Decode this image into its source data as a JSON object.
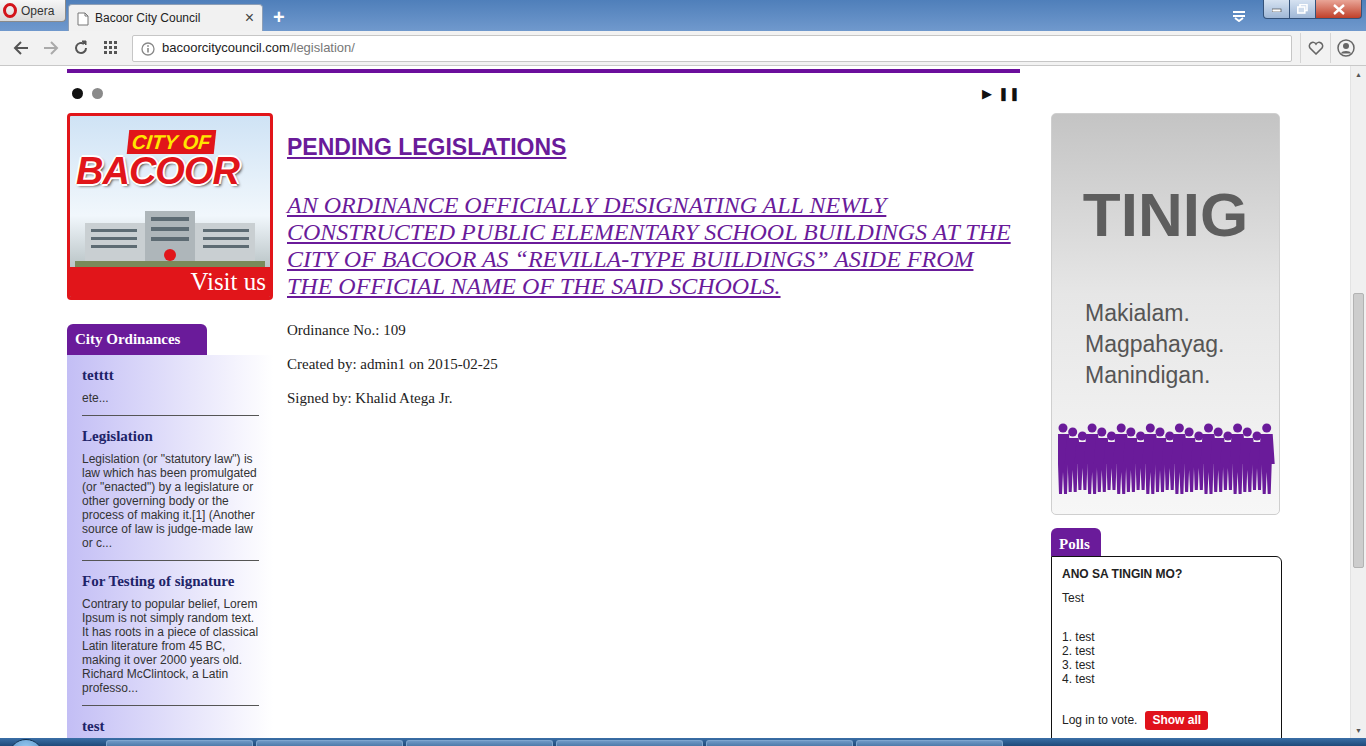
{
  "browser": {
    "menu_button": "Opera",
    "tabs": [
      {
        "label": "Bacoor City Council",
        "close": "×",
        "selected": true
      }
    ],
    "new_tab": "+",
    "address": {
      "host": "bacoorcitycouncil.com",
      "path": "/legislation/"
    }
  },
  "slider": {
    "dots": [
      {
        "selected": true
      },
      {
        "selected": false
      }
    ],
    "play": "▶",
    "pause": "❚❚"
  },
  "logo": {
    "line1": "CITY OF",
    "line2": "BACOOR",
    "cta": "Visit us"
  },
  "ordinances": {
    "title": "City Ordinances",
    "items": [
      {
        "title": "tetttt",
        "excerpt": "ete..."
      },
      {
        "title": "Legislation",
        "excerpt": "Legislation (or \"statutory law\") is law which has been promulgated (or \"enacted\") by a legislature or other governing body or the process of making it.[1] (Another source of law is judge-made law or c..."
      },
      {
        "title": "For Testing of signature",
        "excerpt": "Contrary to popular belief, Lorem Ipsum is not simply random text. It has roots in a piece of classical Latin literature from 45 BC, making it over 2000 years old. Richard McClintock, a Latin professo..."
      },
      {
        "title": "test",
        "excerpt": ""
      }
    ]
  },
  "main": {
    "heading": "PENDING LEGISLATIONS",
    "title": "AN ORDINANCE OFFICIALLY DESIGNATING ALL NEWLY CONSTRUCTED PUBLIC ELEMENTARY SCHOOL BUILDINGS AT THE CITY OF BACOOR AS “REVILLA-TYPE BUILDINGS” ASIDE FROM THE OFFICIAL NAME OF THE SAID SCHOOLS.",
    "fields": [
      "Ordinance No.: 109",
      "Created by: admin1 on 2015-02-25",
      "Signed by: Khalid Atega Jr."
    ]
  },
  "banner": {
    "title": "TINIG",
    "lines": [
      "Makialam.",
      "Magpahayag.",
      "Manindigan."
    ]
  },
  "polls": {
    "title": "Polls",
    "question": "ANO SA TINGIN MO?",
    "description": "Test",
    "options": [
      "1. test",
      "2. test",
      "3. test",
      "4. test"
    ],
    "login": "Log in to vote.",
    "button": "Show all"
  },
  "scrollbar": {
    "up": "▲",
    "down": "▼",
    "thumb_start": 0.33,
    "thumb_size": 0.43
  }
}
